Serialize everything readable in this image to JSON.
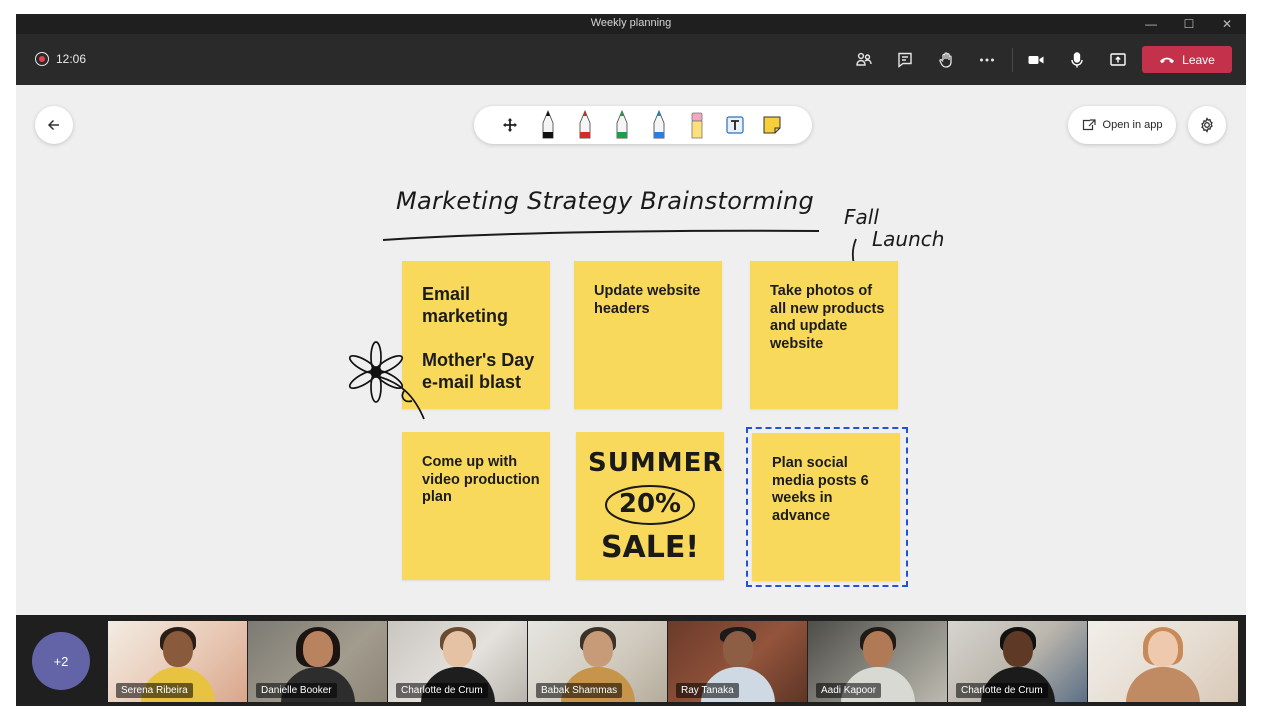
{
  "window": {
    "title": "Weekly planning"
  },
  "meeting": {
    "timer": "12:06",
    "leave_label": "Leave"
  },
  "canvas": {
    "open_in_app_label": "Open in app",
    "board_title": "Marketing Strategy Brainstorming",
    "annotation_line1": "Fall",
    "annotation_line2": "Launch",
    "notes": [
      {
        "text": "Email marketing\n\nMother's Day e-mail blast"
      },
      {
        "text": "Update website headers"
      },
      {
        "text": "Take photos of all new products and update website"
      },
      {
        "text": "Come up with video production plan"
      },
      {
        "text": "SUMMER 20% SALE!"
      },
      {
        "text": "Plan social media posts 6 weeks in advance"
      }
    ],
    "sale": {
      "line1": "SUMMER",
      "line2": "20%",
      "line3": "SALE!"
    }
  },
  "participants": {
    "overflow_label": "+2",
    "tiles": [
      {
        "name": "Serena Ribeira"
      },
      {
        "name": "Danielle Booker"
      },
      {
        "name": "Charlotte de Crum"
      },
      {
        "name": "Babak Shammas"
      },
      {
        "name": "Ray Tanaka"
      },
      {
        "name": "Aadi Kapoor"
      },
      {
        "name": "Charlotte de Crum"
      },
      {
        "name": ""
      }
    ]
  },
  "colors": {
    "leave": "#c4314b",
    "sticky_note": "#f9d95b",
    "selection": "#2054d6",
    "avatar_more": "#6264a7",
    "recording": "#e8414e"
  },
  "icons": [
    "record-icon",
    "participants-icon",
    "chat-icon",
    "raise-hand-icon",
    "more-options-icon",
    "camera-icon",
    "microphone-icon",
    "share-screen-icon",
    "hang-up-icon",
    "back-arrow-icon",
    "move-icon",
    "pen-icon",
    "highlighter-icon",
    "text-icon",
    "sticky-note-icon",
    "open-external-icon",
    "gear-icon"
  ]
}
